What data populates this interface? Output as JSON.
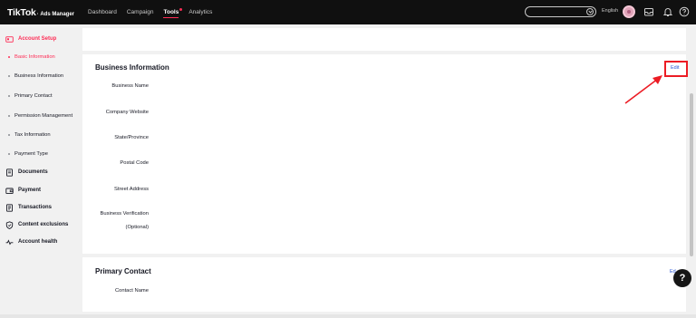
{
  "brand": {
    "name": "TikTok",
    "product": "Ads Manager"
  },
  "nav": [
    {
      "label": "Dashboard"
    },
    {
      "label": "Campaign"
    },
    {
      "label": "Tools"
    },
    {
      "label": "Analytics"
    }
  ],
  "header": {
    "account_select_value": "",
    "language": "English",
    "icons": [
      "avatar",
      "inbox-icon",
      "bell-icon",
      "help-circle-icon"
    ]
  },
  "sidebar": {
    "account_setup": "Account Setup",
    "sub_items": [
      {
        "label": "Basic Information"
      },
      {
        "label": "Business Information"
      },
      {
        "label": "Primary Contact"
      },
      {
        "label": "Permission Management"
      },
      {
        "label": "Tax Information"
      },
      {
        "label": "Payment Type"
      }
    ],
    "groups": [
      {
        "label": "Documents",
        "icon": "document-icon"
      },
      {
        "label": "Payment",
        "icon": "wallet-icon"
      },
      {
        "label": "Transactions",
        "icon": "receipt-icon"
      },
      {
        "label": "Content exclusions",
        "icon": "shield-icon"
      },
      {
        "label": "Account health",
        "icon": "pulse-icon"
      }
    ]
  },
  "business_information": {
    "title": "Business Information",
    "edit_label": "Edit",
    "fields": [
      {
        "label": "Business Name"
      },
      {
        "label": "Company Website"
      },
      {
        "label": "State/Province"
      },
      {
        "label": "Postal Code"
      },
      {
        "label": "Street Address"
      },
      {
        "label": "Business Verification"
      }
    ],
    "optional_note": "(Optional)"
  },
  "primary_contact": {
    "title": "Primary Contact",
    "edit_label": "Ed",
    "fields": [
      {
        "label": "Contact Name"
      }
    ]
  },
  "help_fab": {
    "label": "?"
  },
  "colors": {
    "accent": "#fe2c55",
    "link": "#2a57d6",
    "annotation": "#ec1c24",
    "topbar": "#101010"
  }
}
